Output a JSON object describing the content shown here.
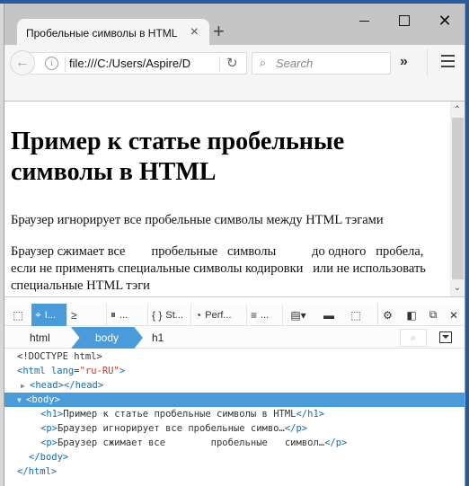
{
  "window": {
    "tab_title": "Пробельные символы в HTML",
    "tab_close_icon": "×",
    "new_tab_icon": "+",
    "minimize_icon": "minimize",
    "maximize_icon": "maximize",
    "close_icon": "✕"
  },
  "navbar": {
    "back_icon": "←",
    "info_icon": "i",
    "url": "file:///C:/Users/Aspire/D",
    "reload_icon": "↻",
    "search_icon": "🔍",
    "search_placeholder": "Search",
    "overflow_icon": "»",
    "menu_icon": "hamburger"
  },
  "page": {
    "h1": "Пример к статье пробельные символы в HTML",
    "p1": "Браузер игнорирует все пробельные символы между HTML тэгами",
    "p2": "Браузер сжимает все        пробельные   символы           до одного   пробела, если не применять специальные символы кодировки   или не использовать специальные HTML тэги"
  },
  "devtools": {
    "tools": [
      {
        "name": "pick-element",
        "icon": "⬚",
        "label": ""
      },
      {
        "name": "inspector",
        "icon": "⌬",
        "label": "I...",
        "active": true
      },
      {
        "name": "console",
        "icon": "≥",
        "label": ""
      },
      {
        "name": "debugger",
        "icon": "⏸",
        "label": "..."
      },
      {
        "name": "style-editor",
        "icon": "{ }",
        "label": "St..."
      },
      {
        "name": "performance",
        "icon": "◔",
        "label": "Perf..."
      },
      {
        "name": "network",
        "icon": "≡",
        "label": "..."
      }
    ],
    "breadcrumbs": [
      "html",
      "body",
      "h1"
    ],
    "active_breadcrumb": "body",
    "tree": {
      "doctype": "<!DOCTYPE html>",
      "html_open_tag": "<html",
      "html_attr_name": "lang",
      "html_attr_eq": "=",
      "html_attr_value": "\"ru-RU\"",
      "html_close_bracket": ">",
      "head": "<head></head>",
      "body_open": "<body>",
      "h1_open": "<h1>",
      "h1_text": "Пример к статье пробельные символы в HTML",
      "h1_close": "</h1>",
      "p1_open": "<p>",
      "p1_text": "Браузер игнорирует все пробельные симво…",
      "p1_close": "</p>",
      "p2_open": "<p>",
      "p2_text": "Браузер сжимает все        пробельные   символ…",
      "p2_close": "</p>",
      "body_close": "</body>",
      "html_close": "</html>"
    }
  }
}
